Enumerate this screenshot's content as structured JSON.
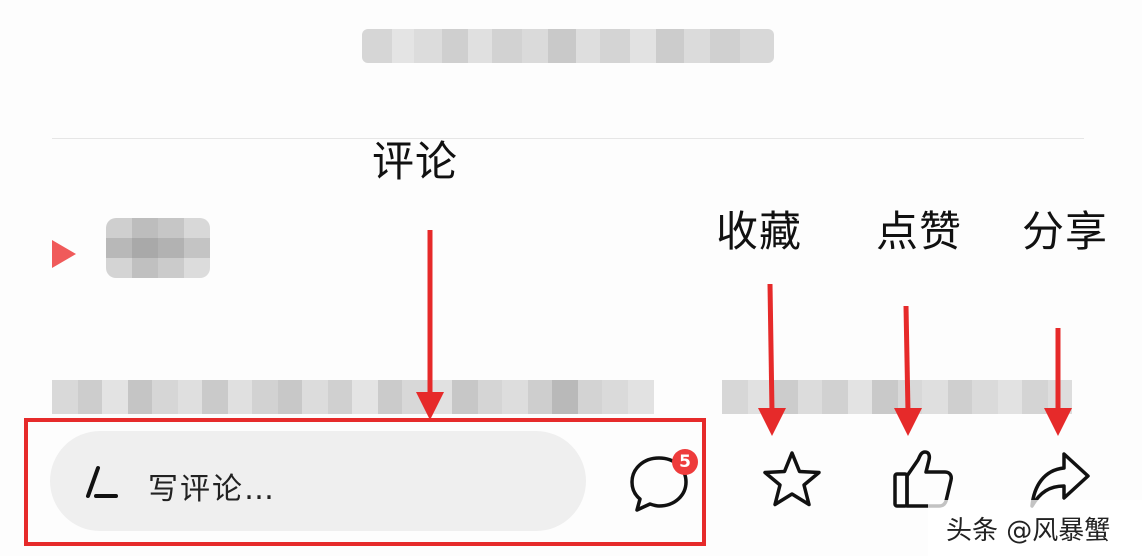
{
  "annotations": {
    "comment": "评论",
    "favorite": "收藏",
    "like": "点赞",
    "share": "分享"
  },
  "bottom_bar": {
    "comment_placeholder": "写评论…",
    "comment_count": "5"
  },
  "watermark": "头条 @风暴蟹",
  "colors": {
    "annotation_red": "#e62a2a",
    "badge_red": "#ee3b3b",
    "play_red": "#f05a5a",
    "input_bg": "#efefef"
  },
  "icons": [
    "pen-icon",
    "comment-bubble-icon",
    "star-icon",
    "thumbs-up-icon",
    "share-arrow-icon",
    "play-triangle-icon"
  ]
}
